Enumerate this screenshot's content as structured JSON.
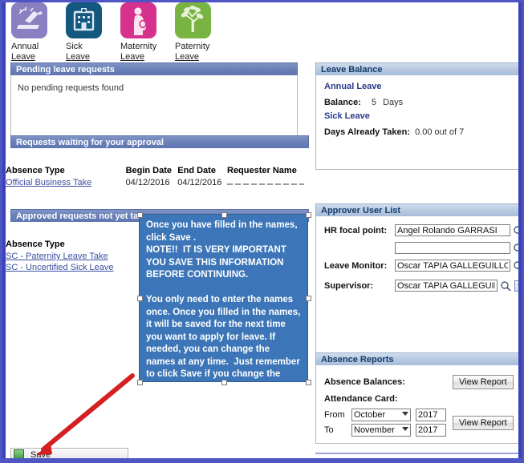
{
  "tiles": [
    {
      "label_line1": "Annual",
      "label_line2": "Leave",
      "icon": "beach-chair-icon",
      "color": "#8a7fc0"
    },
    {
      "label_line1": "Sick",
      "label_line2": "Leave",
      "icon": "hospital-icon",
      "color": "#14577f"
    },
    {
      "label_line1": "Maternity",
      "label_line2": "Leave",
      "icon": "pregnant-woman-icon",
      "color": "#d6318c"
    },
    {
      "label_line1": "Paternity",
      "label_line2": "Leave",
      "icon": "tree-icon",
      "color": "#79b341"
    }
  ],
  "pending": {
    "title": "Pending leave requests",
    "empty_message": "No pending requests found"
  },
  "waiting": {
    "title": "Requests waiting for your approval",
    "columns": [
      "Absence Type",
      "Begin Date",
      "End Date",
      "Requester Name"
    ],
    "rows": [
      {
        "absence_type": "Official Business Take",
        "begin_date": "04/12/2016",
        "end_date": "04/12/2016",
        "requester_name": ""
      }
    ]
  },
  "approved": {
    "title": "Approved requests not yet taken",
    "columns": [
      "Absence Type"
    ],
    "rows": [
      {
        "absence_type": "SC - Paternity Leave Take"
      },
      {
        "absence_type": "SC - Uncertified Sick Leave"
      }
    ]
  },
  "balance": {
    "title": "Leave Balance",
    "annual_label": "Annual Leave",
    "balance_label": "Balance:",
    "balance_value": "5",
    "balance_unit": "Days",
    "sick_label": "Sick Leave",
    "taken_label": "Days Already Taken:",
    "taken_value": "0.00 out of 7"
  },
  "approver": {
    "title": "Approver User List",
    "rows": [
      {
        "label": "HR focal point:",
        "value": "Angel Rolando GARRASI",
        "has_lookup": true,
        "has_add": false,
        "has_remove": false
      },
      {
        "label": "",
        "value": "",
        "has_lookup": true,
        "has_add": false,
        "has_remove": false
      },
      {
        "label": "Leave Monitor:",
        "value": "Oscar TAPIA GALLEGUILLOS",
        "has_lookup": true,
        "has_add": false,
        "has_remove": false
      },
      {
        "label": "Supervisor:",
        "value": "Oscar TAPIA GALLEGUILL",
        "has_lookup": true,
        "has_add": true,
        "has_remove": true
      }
    ],
    "lookup_icon": "magnifier-icon",
    "add_label": "+",
    "remove_label": "−"
  },
  "reports": {
    "title": "Absence Reports",
    "absence_balances_label": "Absence Balances:",
    "attendance_card_label": "Attendance Card:",
    "from_label": "From",
    "to_label": "To",
    "from_month": "October",
    "from_year": "2017",
    "to_month": "November",
    "to_year": "2017",
    "view_report_label": "View Report",
    "view_report_label_2": "View Report"
  },
  "callout": {
    "text": "Once you have filled in the names, click Save .\nNOTE!!  IT IS VERY IMPORTANT YOU SAVE THIS INFORMATION BEFORE CONTINUING.\n\nYou only need to enter the names once. Once you filled in the names, it will be saved for the next time you want to apply for leave. If needed, you can change the names at any time.  Just remember to click Save if you change the names.",
    "background": "#3d76b8"
  },
  "save": {
    "label": "Save",
    "icon": "save-disk-icon"
  },
  "annotation": {
    "arrow_color": "#d42020",
    "arrow_from": "callout",
    "arrow_to": "save-button"
  },
  "colors": {
    "page_border": "#3b42b8",
    "panel_header_dark": "#6a80b8",
    "panel_header_light": "#b7c9e0",
    "link": "#3b4fa0"
  }
}
